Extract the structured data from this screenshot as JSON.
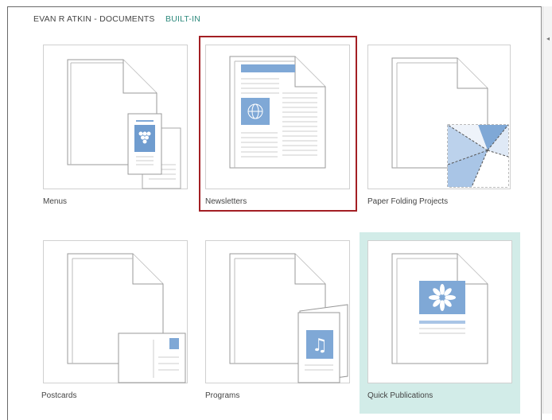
{
  "tabs": [
    {
      "label": "EVAN R ATKIN - DOCUMENTS"
    },
    {
      "label": "BUILT-IN"
    }
  ],
  "templates": [
    {
      "label": "Menus",
      "icon": "menu-template-icon"
    },
    {
      "label": "Newsletters",
      "icon": "newsletter-template-icon",
      "selected": true
    },
    {
      "label": "Paper Folding Projects",
      "icon": "paper-folding-template-icon"
    },
    {
      "label": "Postcards",
      "icon": "postcard-template-icon"
    },
    {
      "label": "Programs",
      "icon": "program-template-icon"
    },
    {
      "label": "Quick Publications",
      "icon": "quick-publication-template-icon",
      "hovered": true
    }
  ],
  "colors": {
    "accent_teal": "#2e8a7d",
    "selection_red": "#a31f24",
    "hover_bg": "#d2ece8",
    "icon_blue": "#7fa8d6"
  }
}
